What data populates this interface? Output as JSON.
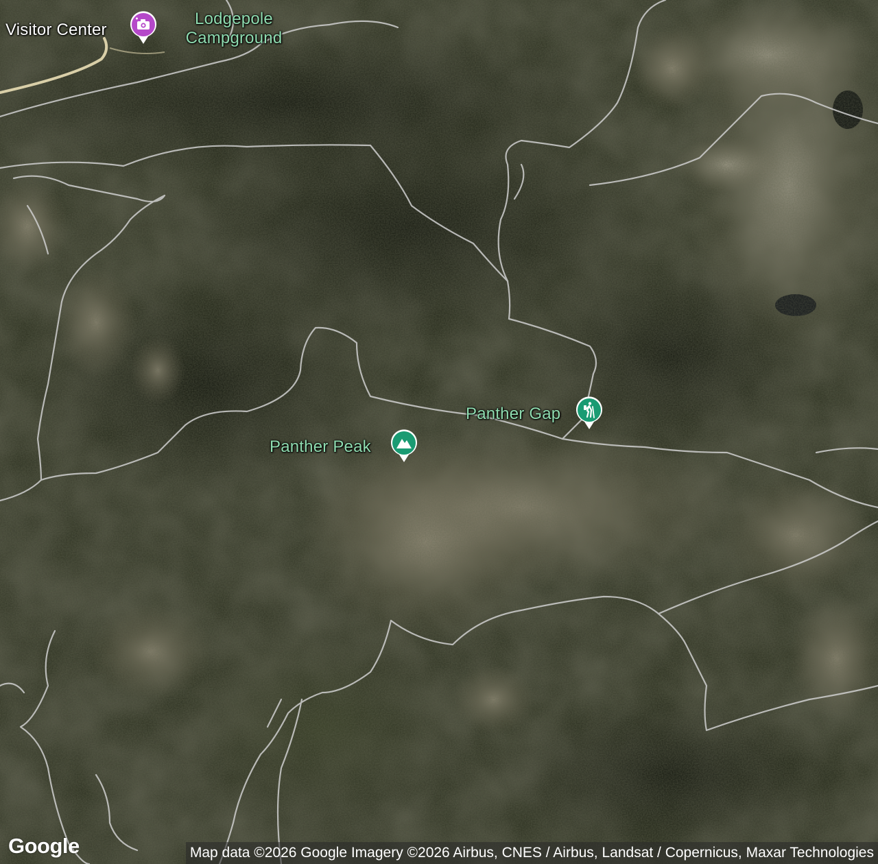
{
  "map": {
    "map_type": "satellite",
    "colors": {
      "poi_green": "#1a9b73",
      "poi_purple": "#b548c9",
      "trail_line": "#cfcfcf",
      "road_line": "#d9cfa8",
      "label_green": "#8fdcb0"
    }
  },
  "places": [
    {
      "id": "visitor-center",
      "label": "Visitor Center",
      "icon": "camera-icon",
      "category": "visitor center",
      "color": "#b548c9"
    },
    {
      "id": "lodgepole",
      "label_line1": "Lodgepole",
      "label_line2": "Campground",
      "category": "campground"
    },
    {
      "id": "panther-gap",
      "label": "Panther Gap",
      "icon": "hiker-icon",
      "category": "trailhead",
      "color": "#1a9b73"
    },
    {
      "id": "panther-peak",
      "label": "Panther Peak",
      "icon": "mountain-icon",
      "category": "summit",
      "color": "#1a9b73"
    }
  ],
  "branding": {
    "logo": "Google"
  },
  "attribution": "Map data ©2026 Google Imagery ©2026 Airbus, CNES / Airbus, Landsat / Copernicus, Maxar Technologies"
}
